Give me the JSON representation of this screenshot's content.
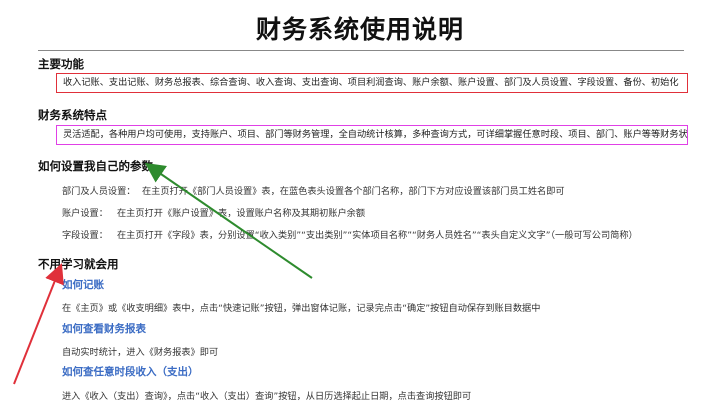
{
  "title": "财务系统使用说明",
  "sections": {
    "main_functions": {
      "heading": "主要功能",
      "content": "收入记账、支出记账、财务总报表、综合查询、收入查询、支出查询、项目利润查询、账户余额、账户设置、部门及人员设置、字段设置、备份、初始化"
    },
    "features": {
      "heading": "财务系统特点",
      "content": "灵活适配，各种用户均可使用，支持账户、项目、部门等财务管理，全自动统计核算，多种查询方式，可详细掌握任意时段、项目、部门、账户等等财务状况"
    },
    "setup": {
      "heading": "如何设置我自己的参数",
      "rows": [
        {
          "label": "部门及人员设置：",
          "text": "在主页打开《部门人员设置》表，在蓝色表头设置各个部门名称，部门下方对应设置该部门员工姓名即可"
        },
        {
          "label": "账户设置：",
          "text": "在主页打开《账户设置》表，设置账户名称及其期初账户余额"
        },
        {
          "label": "字段设置：",
          "text": "在主页打开《字段》表，分别设置“收入类别”“支出类别”“实体项目名称”“财务人员姓名”“表头自定义文字”（一般可写公司简称）"
        }
      ]
    },
    "no_learning": {
      "heading": "不用学习就会用",
      "items": [
        {
          "title": "如何记账",
          "text": "在《主页》或《收支明细》表中，点击“快速记账”按钮，弹出窗体记账，记录完点击“确定”按钮自动保存到账目数据中"
        },
        {
          "title": "如何查看财务报表",
          "text": "自动实时统计，进入《财务报表》即可"
        },
        {
          "title": "如何查任意时段收入（支出）",
          "text": "进入《收入（支出）查询》，点击“收入（支出）查询”按钮，从日历选择起止日期，点击查询按钮即可"
        }
      ]
    }
  },
  "colors": {
    "red_box": "#e0303a",
    "pink_box": "#e040e6",
    "subheading_blue": "#3b6cc4",
    "green_arrow": "#2e8b2e",
    "red_arrow": "#e0303a"
  }
}
